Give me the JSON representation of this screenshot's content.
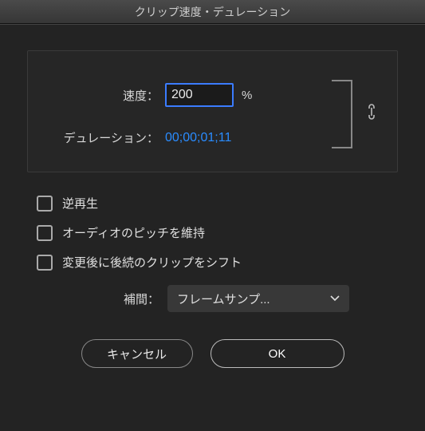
{
  "title": "クリップ速度・デュレーション",
  "panel": {
    "speed_label": "速度：",
    "speed_value": "200",
    "percent": "%",
    "duration_label": "デュレーション：",
    "duration_value": "00;00;01;11"
  },
  "checkboxes": {
    "reverse": "逆再生",
    "pitch": "オーディオのピッチを維持",
    "shift": "変更後に後続のクリップをシフト"
  },
  "interpolation": {
    "label": "補間：",
    "value": "フレームサンプ..."
  },
  "buttons": {
    "cancel": "キャンセル",
    "ok": "OK"
  }
}
